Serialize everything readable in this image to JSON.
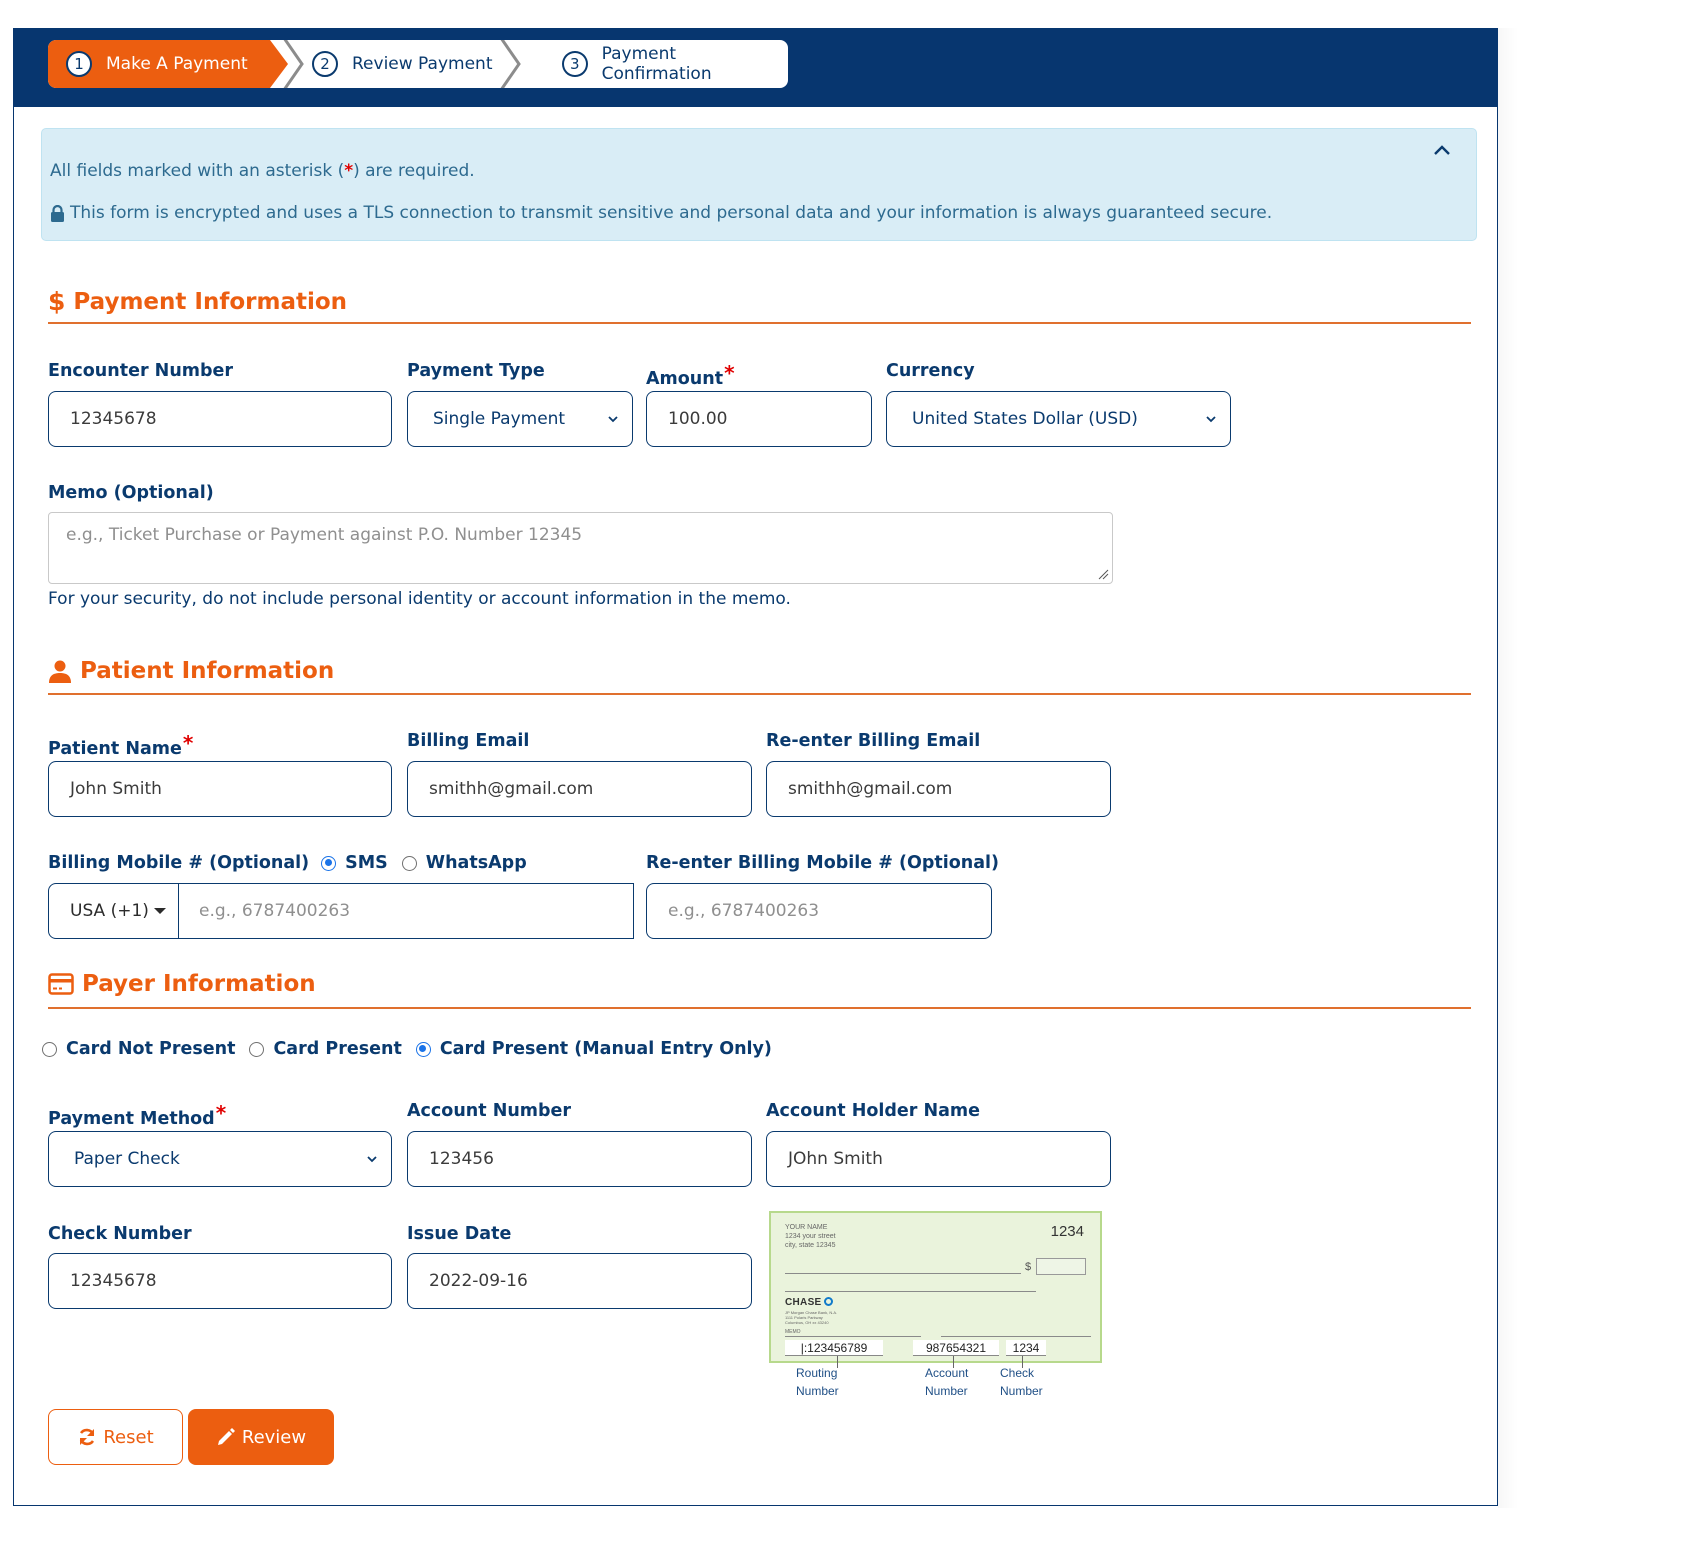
{
  "stepper": {
    "steps": [
      {
        "number": "1",
        "label": "Make A Payment",
        "state": "active"
      },
      {
        "number": "2",
        "label": "Review Payment",
        "state": "pending"
      },
      {
        "number": "3",
        "label": "Payment Confirmation",
        "state": "pending"
      }
    ]
  },
  "notice": {
    "required_prefix": "All fields marked with an asterisk (",
    "required_mark": "*",
    "required_suffix": ") are required.",
    "security_text": "This form is encrypted and uses a TLS connection to transmit sensitive and personal data and your information is always guaranteed secure.",
    "lock_icon": "lock-icon",
    "collapse_icon": "chevron-up-icon"
  },
  "payment_info": {
    "title": "Payment Information",
    "icon": "dollar-icon",
    "encounter_number": {
      "label": "Encounter Number",
      "value": "12345678"
    },
    "payment_type": {
      "label": "Payment Type",
      "value": "Single Payment"
    },
    "amount": {
      "label": "Amount",
      "required": "*",
      "value": "100.00"
    },
    "currency": {
      "label": "Currency",
      "value": "United States Dollar (USD)"
    },
    "memo": {
      "label": "Memo (Optional)",
      "placeholder": "e.g., Ticket Purchase or Payment against P.O. Number 12345",
      "help": "For your security, do not include personal identity or account information in the memo."
    }
  },
  "patient_info": {
    "title": "Patient Information",
    "icon": "user-icon",
    "patient_name": {
      "label": "Patient Name",
      "required": "*",
      "value": "John Smith"
    },
    "billing_email": {
      "label": "Billing Email",
      "value": "smithh@gmail.com"
    },
    "reenter_email": {
      "label": "Re-enter Billing Email",
      "value": "smithh@gmail.com"
    },
    "mobile": {
      "label": "Billing Mobile # (Optional)",
      "channels": [
        {
          "label": "SMS",
          "selected": true
        },
        {
          "label": "WhatsApp",
          "selected": false
        }
      ],
      "country": "USA (+1)",
      "placeholder": "e.g., 6787400263"
    },
    "reenter_mobile": {
      "label": "Re-enter Billing Mobile # (Optional)",
      "placeholder": "e.g., 6787400263"
    }
  },
  "payer_info": {
    "title": "Payer Information",
    "icon": "credit-card-icon",
    "card_modes": [
      {
        "label": "Card Not Present",
        "selected": false
      },
      {
        "label": "Card Present",
        "selected": false
      },
      {
        "label": "Card Present (Manual Entry Only)",
        "selected": true
      }
    ],
    "payment_method": {
      "label": "Payment Method",
      "required": "*",
      "value": "Paper Check"
    },
    "account_number": {
      "label": "Account Number",
      "value": "123456"
    },
    "account_holder": {
      "label": "Account Holder Name",
      "value": "JOhn Smith"
    },
    "check_number": {
      "label": "Check Number",
      "value": "12345678"
    },
    "issue_date": {
      "label": "Issue Date",
      "value": "2022-09-16"
    },
    "check_image": {
      "name_line1": "YOUR NAME",
      "name_line2": "1234 your street",
      "name_line3": "city, state 12345",
      "check_no": "1234",
      "dollar": "$",
      "bank": "CHASE",
      "bank_l1": "JP Morgan Chase Bank, N.A.",
      "bank_l2": "1111 Polaris Parkway",
      "bank_l3": "Columbus, OH xx 43240",
      "memo": "MEMO",
      "routing": "|:123456789",
      "account": "987654321",
      "check": "1234",
      "captions": [
        {
          "l1": "Routing",
          "l2": "Number"
        },
        {
          "l1": "Account",
          "l2": "Number"
        },
        {
          "l1": "Check",
          "l2": "Number"
        }
      ]
    }
  },
  "actions": {
    "reset_label": "Reset",
    "review_label": "Review"
  },
  "colors": {
    "header_bg": "#07366f",
    "accent": "#ec5e10",
    "info_bg": "#d9edf6",
    "required": "#e00000",
    "radio_selected": "#1a73e8"
  }
}
